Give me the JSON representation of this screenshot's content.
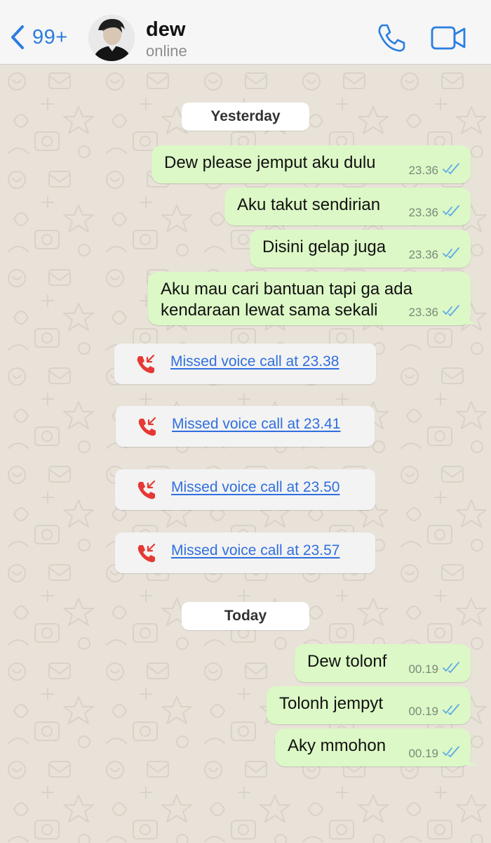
{
  "header": {
    "back_count": "99+",
    "contact_name": "dew",
    "contact_status": "online"
  },
  "colors": {
    "accent": "#2a7de1",
    "bubble_out": "#dcf8c6",
    "wallpaper": "#e8e2d9",
    "missed_call_red": "#e53935",
    "tick_blue": "#5da9e8"
  },
  "icons": {
    "back": "chevron-left-icon",
    "voice_call": "phone-icon",
    "video_call": "video-camera-icon",
    "missed_call": "missed-call-icon",
    "read_receipt": "double-check-icon"
  },
  "chat": {
    "date_yesterday": "Yesterday",
    "yesterday_messages": [
      {
        "text": "Dew please jemput aku dulu",
        "time": "23.36"
      },
      {
        "text": "Aku takut sendirian",
        "time": "23.36"
      },
      {
        "text": "Disini gelap juga",
        "time": "23.36"
      },
      {
        "text": "Aku mau cari bantuan tapi ga ada\nkendaraan lewat sama sekali",
        "time": "23.36"
      }
    ],
    "missed_calls": [
      {
        "text": "Missed voice call at 23.38"
      },
      {
        "text": "Missed voice call at 23.41"
      },
      {
        "text": "Missed voice call at 23.50"
      },
      {
        "text": "Missed voice call at 23.57"
      }
    ],
    "date_today": "Today",
    "today_messages": [
      {
        "text": "Dew tolonf",
        "time": "00.19"
      },
      {
        "text": "Tolonh jempyt",
        "time": "00.19"
      },
      {
        "text": "Aky mmohon",
        "time": "00.19"
      }
    ]
  }
}
